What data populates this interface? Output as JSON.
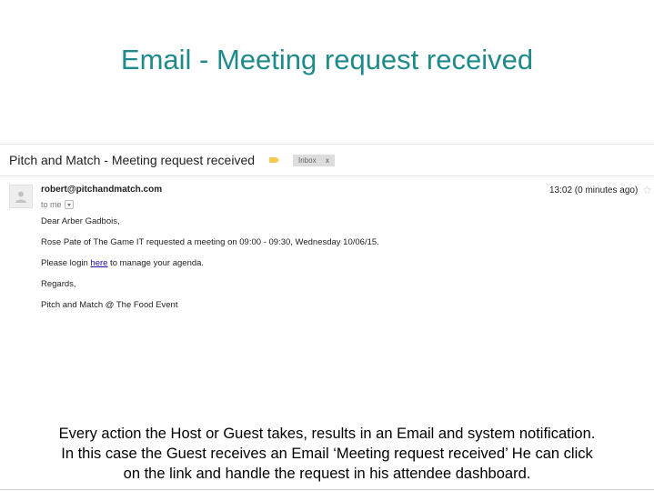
{
  "slide": {
    "title": "Email - Meeting request received",
    "caption_lines": [
      "Every action the Host or Guest takes, results in an Email and system notification.",
      "In this case the Guest receives an Email ‘Meeting request received’ He can click",
      "on the link and handle the request in his attendee dashboard."
    ]
  },
  "email": {
    "subject": "Pitch and Match - Meeting request received",
    "label_chip": "Inbox",
    "label_chip_close": "x",
    "sender": "robert@pitchandmatch.com",
    "to": "to me",
    "timestamp": "13:02 (0 minutes ago)",
    "greeting": "Dear Arber Gadbois,",
    "line1": "Rose Pate of The Game IT requested a meeting on 09:00 - 09:30, Wednesday 10/06/15.",
    "line2_before": "Please login ",
    "line2_link": "here",
    "line2_after": " to manage your agenda.",
    "regards": "Regards,",
    "signature": "Pitch and Match @ The Food Event"
  },
  "colors": {
    "title": "#1f8a8c",
    "label_tag": "#f2c94c",
    "link": "#1a0dab"
  },
  "icons": {
    "avatar": "person-icon",
    "star": "star-icon",
    "label": "label-tag-icon",
    "dropdown": "chevron-down-icon"
  }
}
